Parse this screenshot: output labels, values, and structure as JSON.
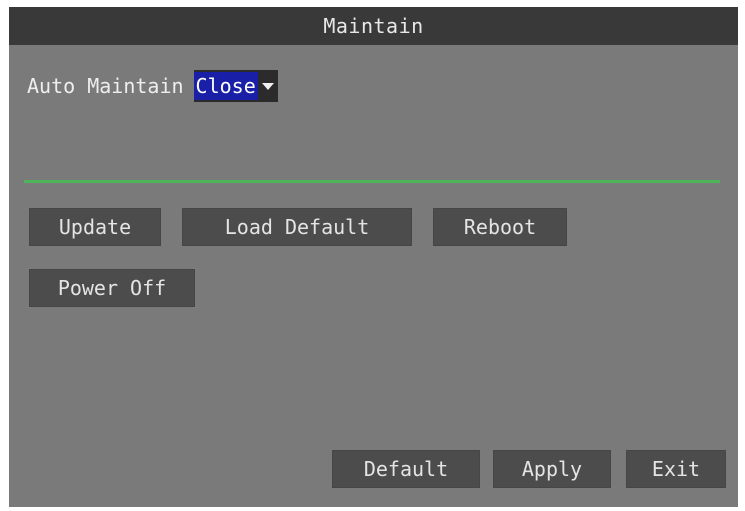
{
  "window": {
    "title": "Maintain"
  },
  "auto_maintain": {
    "label": "Auto Maintain",
    "selected_value": "Close",
    "dropdown_icon": "caret-down-icon"
  },
  "actions": {
    "update_label": "Update",
    "load_default_label": "Load Default",
    "reboot_label": "Reboot",
    "power_off_label": "Power Off"
  },
  "footer": {
    "default_label": "Default",
    "apply_label": "Apply",
    "exit_label": "Exit"
  },
  "colors": {
    "panel_background": "#7a7a7a",
    "title_bar": "#393939",
    "selection_highlight": "#1a1fa8",
    "divider_line": "#4fb35a",
    "button_background": "#4c4c4c"
  }
}
